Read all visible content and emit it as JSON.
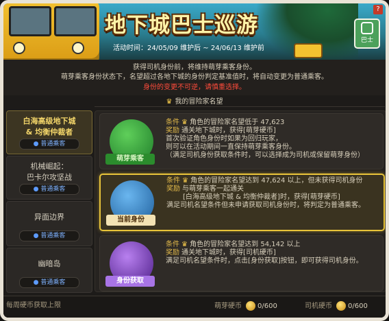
{
  "banner": {
    "title": "地下城巴士巡游",
    "period": "活动时间：24/05/09 维护后 ~ 24/06/13 维护前",
    "bus_button_label": "巴士",
    "help_label": "?"
  },
  "notice": {
    "line1": "获得司机身份前，将维持萌芽乘客身份。",
    "line2": "萌芽乘客身份状态下，名望超过各地下城的身份判定基准值时，将自动变更为普通乘客。",
    "line3": "身份的变更不可逆，请慎重选择。"
  },
  "rank_label": "我的冒险家名望",
  "dungeons": [
    {
      "name": "白海高级地下城\n& 均衡仲裁者",
      "status": "普通乘客",
      "selected": true
    },
    {
      "name": "机械崛起：\n巴卡尔攻坚战",
      "status": "普通乘客",
      "selected": false
    },
    {
      "name": "异面边界",
      "status": "普通乘客",
      "selected": false
    },
    {
      "name": "幽暗岛",
      "status": "普通乘客",
      "selected": false
    }
  ],
  "cards": [
    {
      "badge": "萌芽乘客",
      "cond_tag": "条件",
      "cond": "角色的冒险家名望低于 47,623",
      "reward_tag": "奖励",
      "reward": "通关地下城时，获得[萌芽硬币]",
      "extra1": "首次验证角色身份时如果为回归玩家，",
      "extra2": "则可以在活动期间一直保持萌芽乘客身份。",
      "extra3": "（满足司机身份获取条件时，可以选择成为司机或保留萌芽身份）",
      "extra4": ""
    },
    {
      "badge": "当前身份",
      "cond_tag": "条件",
      "cond": "角色的冒险家名望达到 47,624 以上，但未获得司机身份",
      "reward_tag": "奖励",
      "reward": "与萌芽乘客一起通关",
      "extra1": "[白海高级地下城 & 均衡仲裁者]时，获得[萌芽硬币]",
      "extra2": "满足司机名望条件但未申请获取司机身份时，将判定为普通乘客。",
      "extra3": "",
      "extra4": ""
    },
    {
      "badge": "身份获取",
      "cond_tag": "条件",
      "cond": "角色的冒险家名望达到 54,142 以上",
      "reward_tag": "奖励",
      "reward": "通关地下城时，获得[司机硬币]",
      "extra1": "满足司机名望条件时，点击[身份获取]按钮，即可获得司机身份。",
      "extra2": "",
      "extra3": "",
      "extra4": ""
    }
  ],
  "footer": {
    "weekly_label": "每周硬币获取上限",
    "sprout_coin_label": "萌芽硬币",
    "sprout_coin_count": "0/600",
    "driver_coin_label": "司机硬币",
    "driver_coin_count": "0/600"
  },
  "colors": {
    "accent": "#e8c43a",
    "warning": "#ff4b3b",
    "status_blue": "#7fb2ff"
  }
}
